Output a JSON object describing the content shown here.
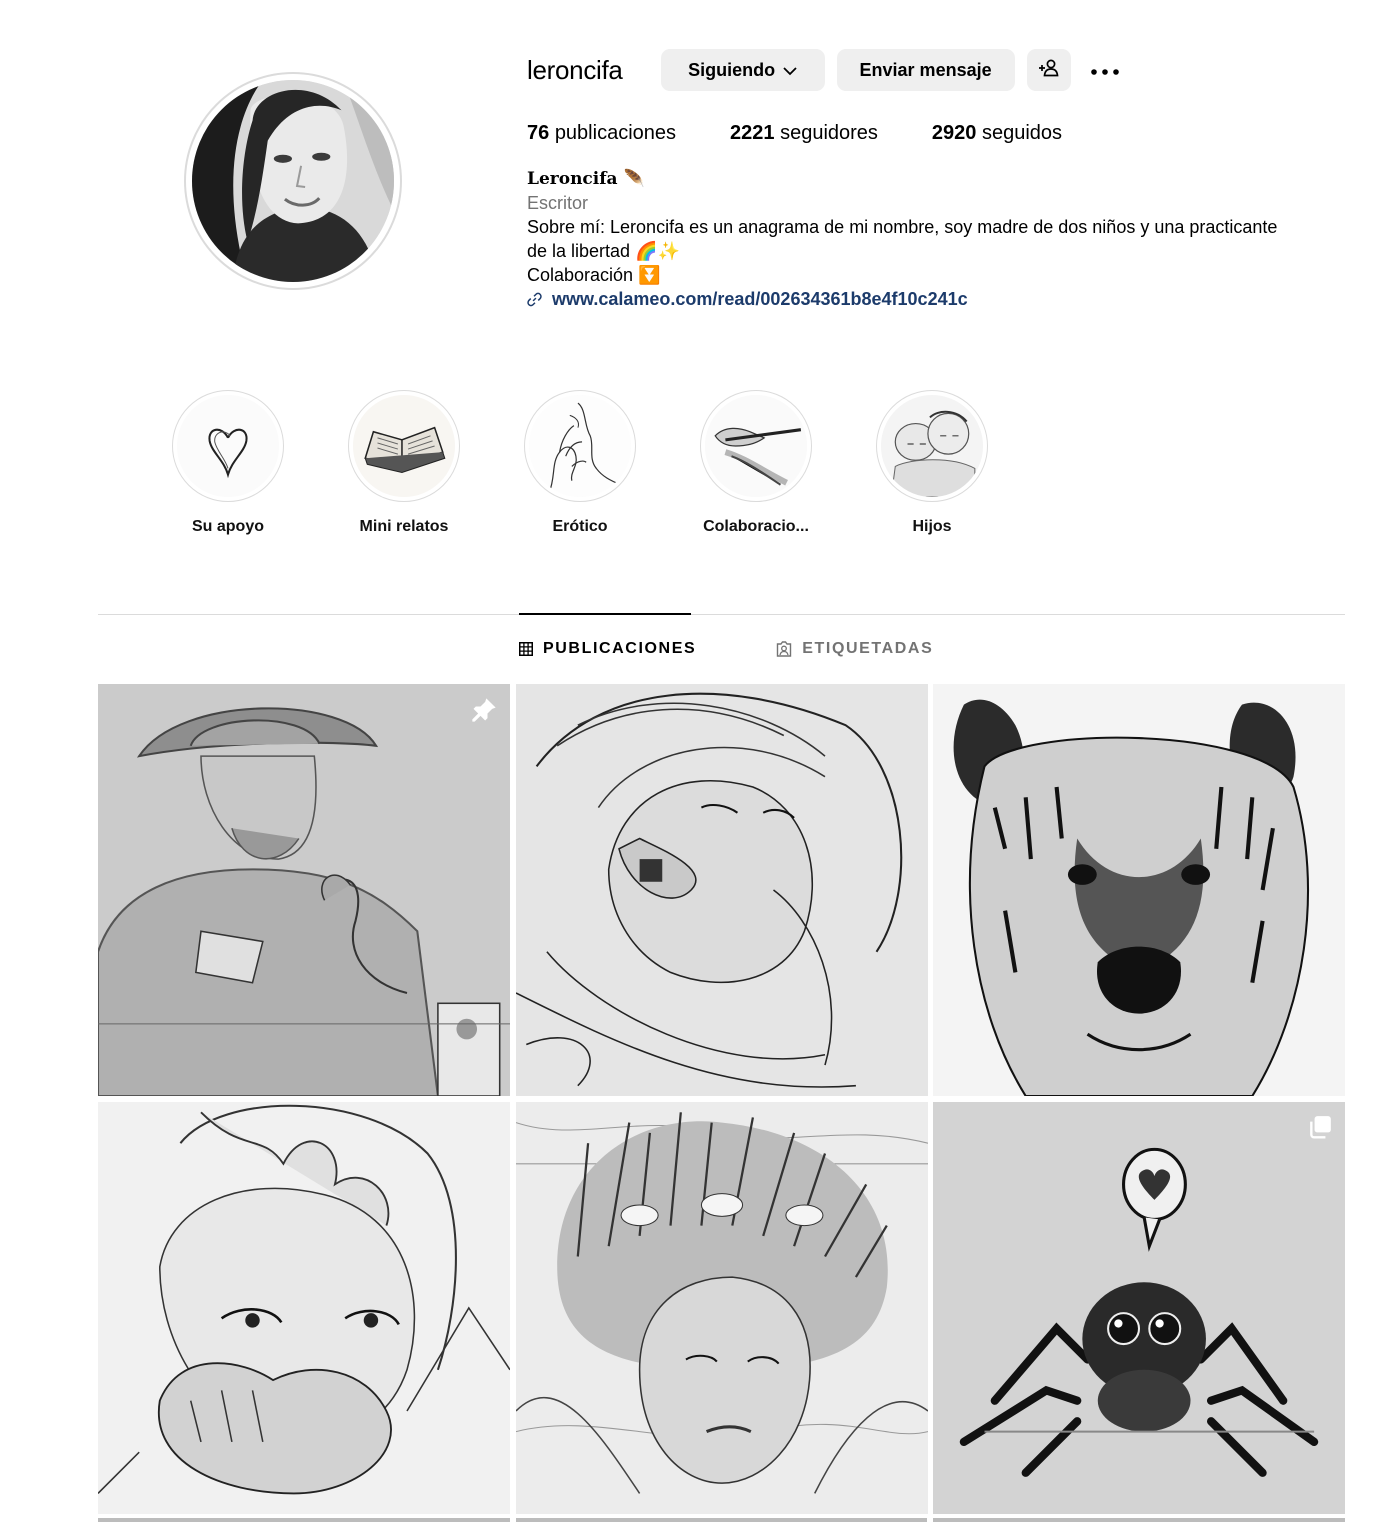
{
  "profile": {
    "username": "leroncifa",
    "buttons": {
      "following": "Siguiendo",
      "message": "Enviar mensaje"
    },
    "stats": [
      {
        "count": "76",
        "label": "publicaciones"
      },
      {
        "count": "2221",
        "label": "seguidores"
      },
      {
        "count": "2920",
        "label": "seguidos"
      }
    ],
    "bio": {
      "name": "Leroncifa 🪶",
      "category": "Escritor",
      "line1": "Sobre mí: Leroncifa es un anagrama de mi nombre, soy madre de dos niños y una practicante",
      "line2": "de la libertad 🌈✨",
      "line3": "Colaboración ⏬",
      "link": "www.calameo.com/read/002634361b8e4f10c241c"
    }
  },
  "highlights": [
    {
      "label": "Su apoyo",
      "icon": "heart-sketch"
    },
    {
      "label": "Mini relatos",
      "icon": "open-book"
    },
    {
      "label": "Erótico",
      "icon": "hand-sketch"
    },
    {
      "label": "Colaboracio...",
      "icon": "pen-hand"
    },
    {
      "label": "Hijos",
      "icon": "babies-sketch"
    }
  ],
  "tabs": {
    "posts": "PUBLICACIONES",
    "tagged": "ETIQUETADAS"
  },
  "posts": [
    {
      "subject": "old-man-drawing",
      "pinned": true
    },
    {
      "subject": "woman-face-lines",
      "pinned": false
    },
    {
      "subject": "hyena-ink",
      "pinned": false
    },
    {
      "subject": "boy-hands-face",
      "pinned": false
    },
    {
      "subject": "girl-hair-fish",
      "pinned": false
    },
    {
      "subject": "jumping-spider-heart",
      "multiple": true
    }
  ],
  "colors": {
    "button_bg": "#efefef",
    "link": "#1c3b6b",
    "muted": "#737373",
    "border": "#dbdbdb"
  }
}
